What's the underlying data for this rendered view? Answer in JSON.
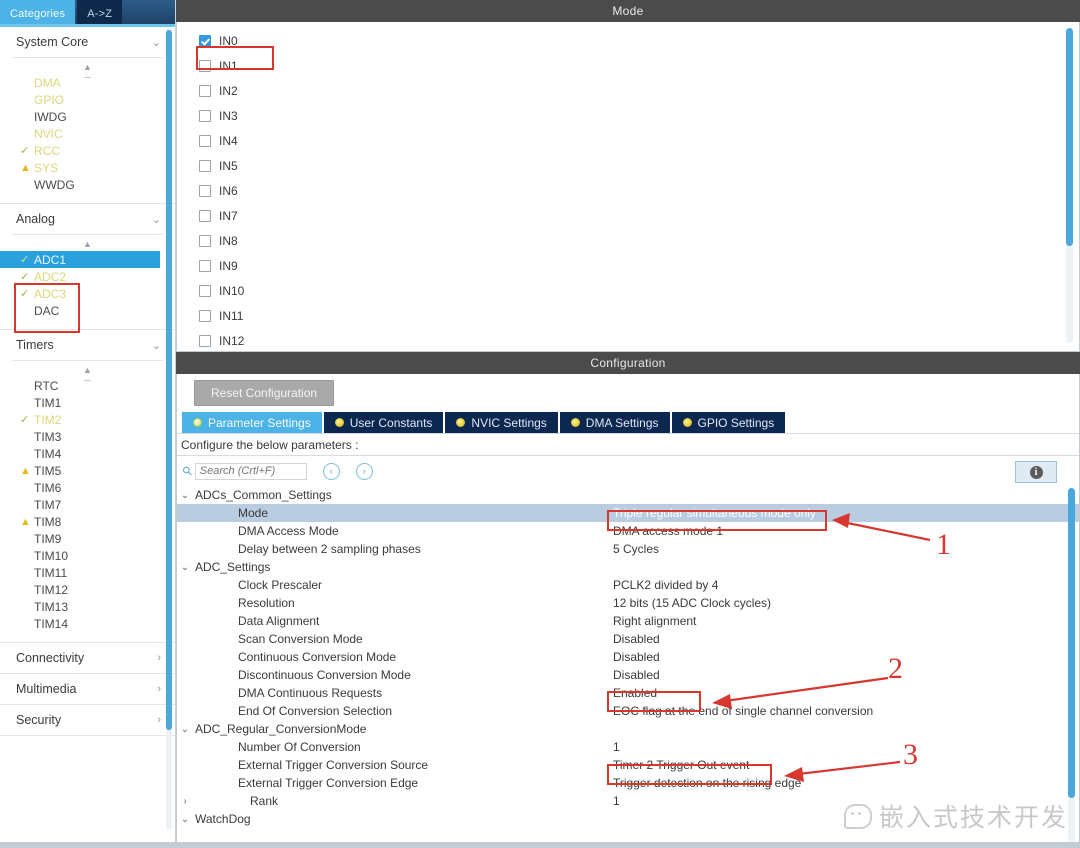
{
  "sidebar": {
    "tabs": [
      {
        "label": "Categories",
        "active": true
      },
      {
        "label": "A->Z",
        "active": false
      }
    ],
    "groups": [
      {
        "title": "System Core",
        "expanded": true,
        "items": [
          {
            "label": "DMA",
            "status": "none",
            "dim": true
          },
          {
            "label": "GPIO",
            "status": "none",
            "dim": true
          },
          {
            "label": "IWDG",
            "status": "none",
            "dim": false
          },
          {
            "label": "NVIC",
            "status": "none",
            "dim": true
          },
          {
            "label": "RCC",
            "status": "ok",
            "dim": true
          },
          {
            "label": "SYS",
            "status": "warn",
            "dim": true
          },
          {
            "label": "WWDG",
            "status": "none",
            "dim": false
          }
        ]
      },
      {
        "title": "Analog",
        "expanded": true,
        "items": [
          {
            "label": "ADC1",
            "status": "ok",
            "dim": true,
            "selected": true
          },
          {
            "label": "ADC2",
            "status": "ok",
            "dim": true
          },
          {
            "label": "ADC3",
            "status": "ok",
            "dim": true
          },
          {
            "label": "DAC",
            "status": "none",
            "dim": false
          }
        ]
      },
      {
        "title": "Timers",
        "expanded": true,
        "items": [
          {
            "label": "RTC",
            "status": "none",
            "dim": false
          },
          {
            "label": "TIM1",
            "status": "none",
            "dim": false
          },
          {
            "label": "TIM2",
            "status": "ok",
            "dim": true
          },
          {
            "label": "TIM3",
            "status": "none",
            "dim": false
          },
          {
            "label": "TIM4",
            "status": "none",
            "dim": false
          },
          {
            "label": "TIM5",
            "status": "warn",
            "dim": false
          },
          {
            "label": "TIM6",
            "status": "none",
            "dim": false
          },
          {
            "label": "TIM7",
            "status": "none",
            "dim": false
          },
          {
            "label": "TIM8",
            "status": "warn",
            "dim": false
          },
          {
            "label": "TIM9",
            "status": "none",
            "dim": false
          },
          {
            "label": "TIM10",
            "status": "none",
            "dim": false
          },
          {
            "label": "TIM11",
            "status": "none",
            "dim": false
          },
          {
            "label": "TIM12",
            "status": "none",
            "dim": false
          },
          {
            "label": "TIM13",
            "status": "none",
            "dim": false
          },
          {
            "label": "TIM14",
            "status": "none",
            "dim": false
          }
        ]
      },
      {
        "title": "Connectivity",
        "expanded": false,
        "items": []
      },
      {
        "title": "Multimedia",
        "expanded": false,
        "items": []
      },
      {
        "title": "Security",
        "expanded": false,
        "items": []
      }
    ]
  },
  "mode_panel": {
    "title": "Mode",
    "channels": [
      {
        "label": "IN0",
        "checked": true
      },
      {
        "label": "IN1",
        "checked": false
      },
      {
        "label": "IN2",
        "checked": false
      },
      {
        "label": "IN3",
        "checked": false
      },
      {
        "label": "IN4",
        "checked": false
      },
      {
        "label": "IN5",
        "checked": false
      },
      {
        "label": "IN6",
        "checked": false
      },
      {
        "label": "IN7",
        "checked": false
      },
      {
        "label": "IN8",
        "checked": false
      },
      {
        "label": "IN9",
        "checked": false
      },
      {
        "label": "IN10",
        "checked": false
      },
      {
        "label": "IN11",
        "checked": false
      },
      {
        "label": "IN12",
        "checked": false
      }
    ]
  },
  "configuration": {
    "title": "Configuration",
    "reset_label": "Reset Configuration",
    "tabs": [
      {
        "label": "Parameter Settings",
        "active": true
      },
      {
        "label": "User Constants",
        "active": false
      },
      {
        "label": "NVIC Settings",
        "active": false
      },
      {
        "label": "DMA Settings",
        "active": false
      },
      {
        "label": "GPIO Settings",
        "active": false
      }
    ],
    "hint": "Configure the below parameters :",
    "search_placeholder": "Search (Crtl+F)",
    "prev_label": "‹",
    "next_label": "›",
    "info_label": "i",
    "tree": [
      {
        "kind": "group",
        "label": "ADCs_Common_Settings",
        "arrow": "∨",
        "value": ""
      },
      {
        "kind": "child",
        "label": "Mode",
        "value": "Triple regular simultaneous mode only",
        "selected": true
      },
      {
        "kind": "child",
        "label": "DMA Access Mode",
        "value": "DMA access mode 1"
      },
      {
        "kind": "child",
        "label": "Delay between 2 sampling phases",
        "value": "5 Cycles"
      },
      {
        "kind": "group",
        "label": "ADC_Settings",
        "arrow": "∨",
        "value": ""
      },
      {
        "kind": "child",
        "label": "Clock Prescaler",
        "value": "PCLK2 divided by 4"
      },
      {
        "kind": "child",
        "label": "Resolution",
        "value": "12 bits (15 ADC Clock cycles)"
      },
      {
        "kind": "child",
        "label": "Data Alignment",
        "value": "Right alignment"
      },
      {
        "kind": "child",
        "label": "Scan Conversion Mode",
        "value": "Disabled"
      },
      {
        "kind": "child",
        "label": "Continuous Conversion Mode",
        "value": "Disabled"
      },
      {
        "kind": "child",
        "label": "Discontinuous Conversion Mode",
        "value": "Disabled"
      },
      {
        "kind": "child",
        "label": "DMA Continuous Requests",
        "value": "Enabled"
      },
      {
        "kind": "child",
        "label": "End Of Conversion Selection",
        "value": "EOC flag at the end of single channel conversion"
      },
      {
        "kind": "group",
        "label": "ADC_Regular_ConversionMode",
        "arrow": "∨",
        "value": ""
      },
      {
        "kind": "child",
        "label": "Number Of Conversion",
        "value": "1"
      },
      {
        "kind": "child",
        "label": "External Trigger Conversion Source",
        "value": "Timer 2 Trigger Out event"
      },
      {
        "kind": "child",
        "label": "External Trigger Conversion Edge",
        "value": "Trigger detection on the rising edge"
      },
      {
        "kind": "child2",
        "label": "Rank",
        "arrow": "›",
        "value": "1"
      },
      {
        "kind": "group",
        "label": "WatchDog",
        "arrow": "∨",
        "value": ""
      }
    ]
  },
  "annotations": {
    "numbers": [
      "1",
      "2",
      "3"
    ],
    "accent_color": "#d6372f"
  },
  "watermark": {
    "text": "嵌入式技术开发"
  }
}
